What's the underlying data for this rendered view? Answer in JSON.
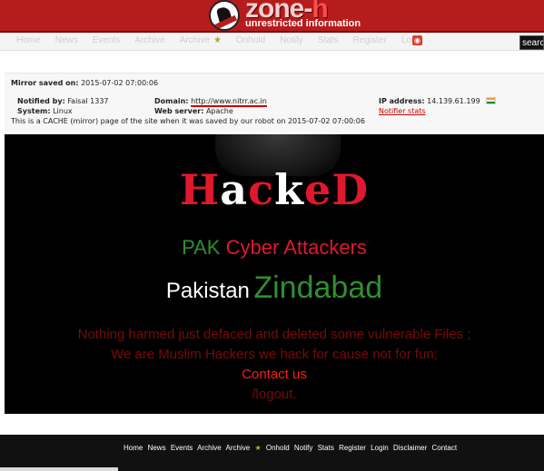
{
  "header": {
    "logo_title": "zone-",
    "logo_title_accent": "h",
    "logo_tagline": "unrestricted information"
  },
  "topnav": {
    "items": [
      "Home",
      "News",
      "Events",
      "Archive",
      "Archive",
      "Onhold",
      "Notify",
      "Stats",
      "Register",
      "Login"
    ],
    "search_placeholder": "search..."
  },
  "mirror": {
    "saved_label": "Mirror saved on:",
    "saved_value": "2015-07-02 07:00:06",
    "notified_label": "Notified by:",
    "notified_value": "Faisal 1337",
    "system_label": "System:",
    "system_value": "Linux",
    "domain_label": "Domain:",
    "domain_value": "http://www.nitrr.ac.in",
    "webserver_label": "Web server:",
    "webserver_value": "Apache",
    "ip_label": "IP address:",
    "ip_value": "14.139.61.199",
    "notifier_stats": "Notifier stats",
    "cache_note": "This is a CACHE (mirror) page of the site when it was saved by our robot on 2015-07-02 07:00:06"
  },
  "hacked_page": {
    "title_parts": [
      "H",
      "a",
      "c",
      "k",
      "e",
      "D"
    ],
    "pak": "PAK",
    "cyber_attackers": "Cyber Attackers",
    "pakistan": "Pakistan",
    "zindabad": "Zindabad",
    "message_line_1": "Nothing harmed just defaced and deleted some vulnerable Files ;",
    "message_line_2": "We are Muslim Hackers we hack for cause not for fun;",
    "contact": "Contact us",
    "logout": "/logout."
  },
  "footer": {
    "items": [
      "Home",
      "News",
      "Events",
      "Archive",
      "Archive",
      "Onhold",
      "Notify",
      "Stats",
      "Register",
      "Login",
      "Disclaimer",
      "Contact"
    ]
  },
  "colors": {
    "header_red": "#b71c1c",
    "hacked_red": "#e0182d",
    "pak_green": "#2f8f2f",
    "dark_red": "#7a0a0a"
  }
}
